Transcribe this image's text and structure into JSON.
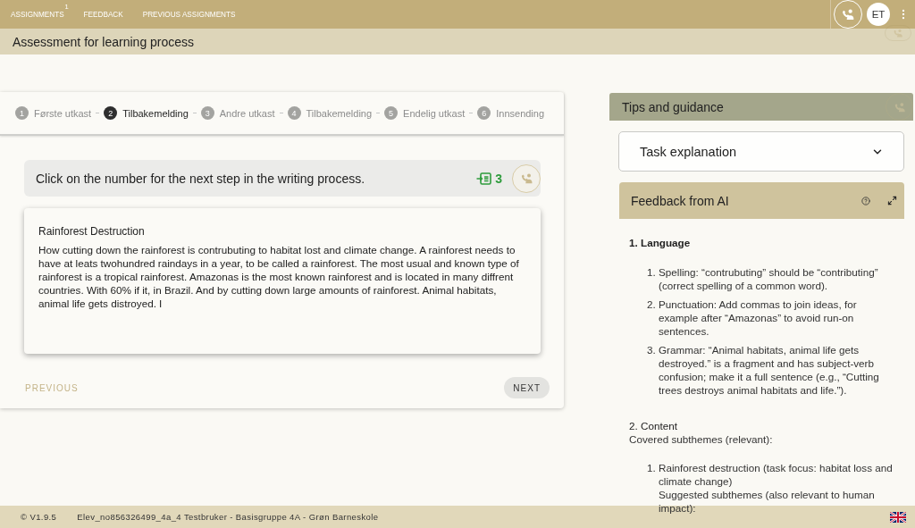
{
  "top_bar": {
    "nav": [
      {
        "label": "ASSIGNMENTS",
        "badge": "1"
      },
      {
        "label": "FEEDBACK"
      },
      {
        "label": "PREVIOUS ASSIGNMENTS"
      }
    ],
    "avatar": "ET"
  },
  "page_title": "Assessment for learning process",
  "steps": [
    {
      "number": "1",
      "label": "Første utkast",
      "selected": false
    },
    {
      "number": "2",
      "label": "Tilbakemelding",
      "selected": true
    },
    {
      "number": "3",
      "label": "Andre utkast",
      "selected": false
    },
    {
      "number": "4",
      "label": "Tilbakemelding",
      "selected": false
    },
    {
      "number": "5",
      "label": "Endelig utkast",
      "selected": false
    },
    {
      "number": "6",
      "label": "Innsending",
      "selected": false
    }
  ],
  "instruction": {
    "text": "Click on the number for the next step in the writing process.",
    "count": "3"
  },
  "draft": {
    "title": "Rainforest Destruction",
    "text": "How cutting down the rainforest is contrubuting to habitat lost and climate change. A rainforest needs to have at leats twohundred raindays in a year, to be called a rainforest. The most usual and known type of rainforest is a tropical rainforest. Amazonas is the most known rainforest and is located in many diffrent countries. With 60% if it, in Brazil. And by cutting down large amounts of rainforest. Animal habitats, animal life gets distroyed. I"
  },
  "navigation": {
    "previous": {
      "label": "PREVIOUS",
      "disabled": true
    },
    "next": {
      "label": "NEXT",
      "disabled": false
    }
  },
  "tips_panel": {
    "title": "Tips and guidance",
    "task_explanation": {
      "label": "Task explanation",
      "expanded": false
    },
    "feedback": {
      "title": "Feedback from AI",
      "sections": [
        {
          "heading": "1. Language",
          "items": [
            {
              "number": "1.",
              "text": "Spelling: “contrubuting” should be “contributing” (correct spelling of a common word)."
            },
            {
              "number": "2.",
              "text": "Punctuation: Add commas to join ideas, for example after “Amazonas” to avoid run-on sentences."
            },
            {
              "number": "3.",
              "text": "Grammar: “Animal habitats, animal life gets destroyed.” is a fragment and has subject-verb confusion; make it a full sentence (e.g., “Cutting trees destroys animal habitats and life.”)."
            }
          ]
        },
        {
          "heading": "2. Content",
          "intro": "Covered subthemes (relevant):",
          "items": [
            {
              "number": "1.",
              "text": "Rainforest destruction (task focus: habitat loss and climate change)",
              "note": "Suggested subthemes (also relevant to human impact):"
            }
          ]
        }
      ]
    }
  },
  "footer": {
    "version": "© V1.9.5",
    "user": "Elev_no856326499_4a_4 Testbruker - Basisgruppe 4A - Grøn Barneskole"
  }
}
